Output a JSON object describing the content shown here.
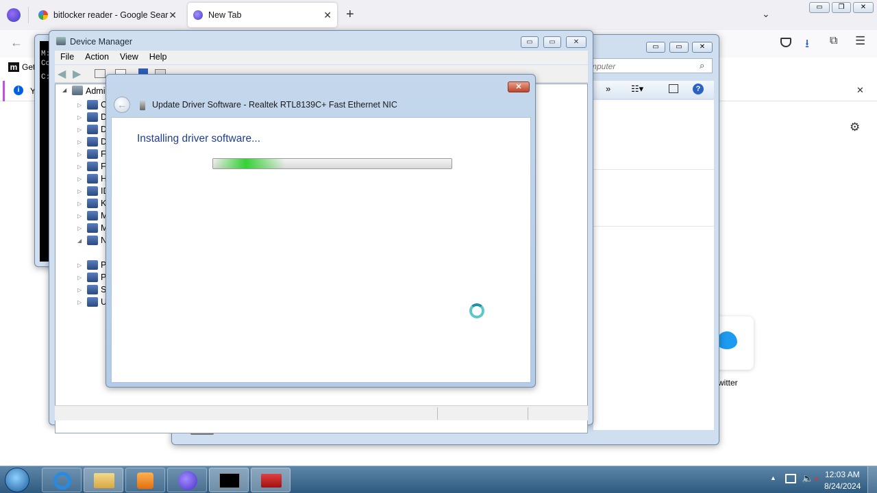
{
  "browser": {
    "tabs": [
      {
        "title": "bitlocker reader - Google Search",
        "favicon": "google-icon"
      },
      {
        "title": "New Tab",
        "favicon": "firefox-icon"
      }
    ],
    "bookmark_label": "Get",
    "notice_text": "Y",
    "tile_label": "witter"
  },
  "explorer": {
    "search_placeholder": "mputer",
    "cmd_lines": [
      "M:",
      "Co",
      "C:"
    ]
  },
  "device_manager": {
    "title": "Device Manager",
    "menu": [
      "File",
      "Action",
      "View",
      "Help"
    ],
    "tree_root": "Admi",
    "tree_items": [
      "Co",
      "Di",
      "Di",
      "DV",
      "Flo",
      "Flo",
      "HC",
      "ID",
      "Ke",
      "M",
      "Mo",
      "Ne",
      "",
      "Po",
      "Pr",
      "Sy",
      "Ur"
    ]
  },
  "dialog": {
    "title": "Update Driver Software - Realtek RTL8139C+ Fast Ethernet NIC",
    "heading": "Installing driver software...",
    "progress_fraction": 0.3
  },
  "taskbar": {
    "time": "12:03 AM",
    "date": "8/24/2024"
  },
  "colors": {
    "dialog_heading": "#1e3e8c",
    "progress_green": "#35d135"
  }
}
